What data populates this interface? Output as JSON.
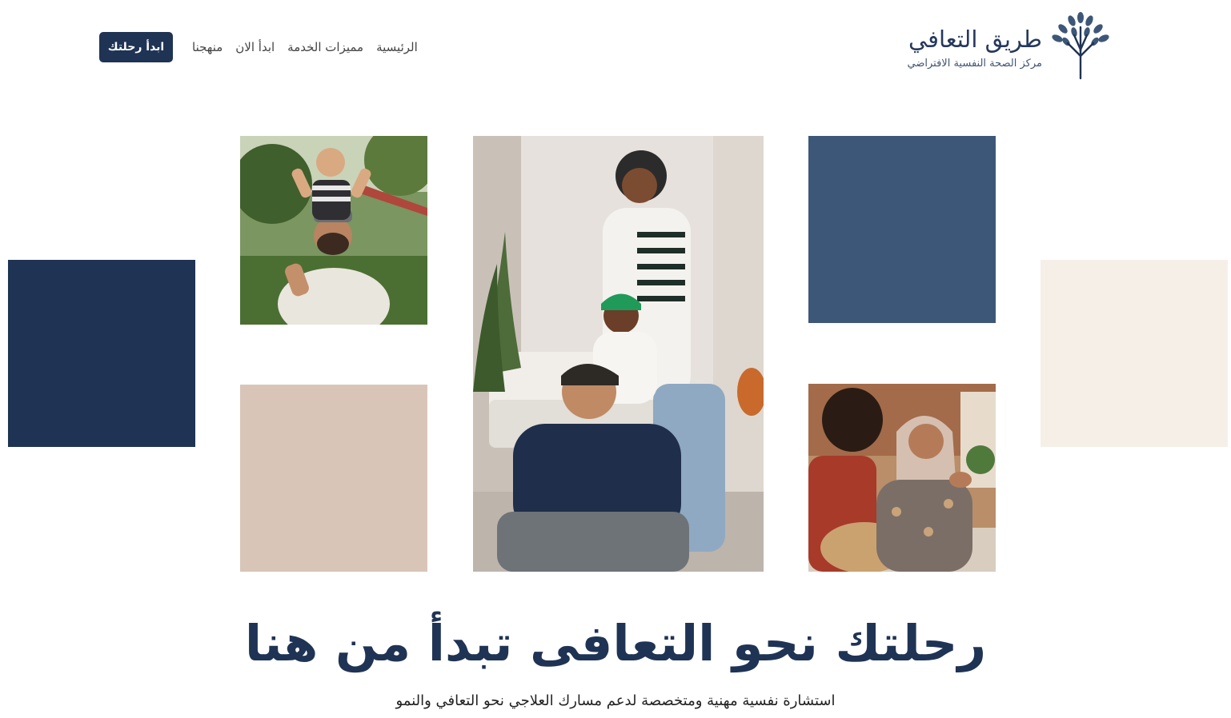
{
  "brand": {
    "name": "طريق التعافي",
    "tagline": "مركز الصحة النفسية الافتراضي",
    "logo_icon": "tree-icon"
  },
  "nav": {
    "items": [
      {
        "label": "الرئيسية"
      },
      {
        "label": "مميزات الخدمة"
      },
      {
        "label": "ابدأ الان"
      },
      {
        "label": "منهجنا"
      }
    ]
  },
  "cta": {
    "label": "ابدأ رحلتك"
  },
  "hero": {
    "title": "رحلتك نحو التعافى تبدأ من هنا",
    "subtitle": "استشارة نفسية مهنية ومتخصصة لدعم مسارك العلاجي نحو التعافي والنمو"
  },
  "colors": {
    "navy": "#1f3354",
    "slate_blue": "#3d5778",
    "beige": "#d9c5b7",
    "cream": "#f5efe8"
  }
}
